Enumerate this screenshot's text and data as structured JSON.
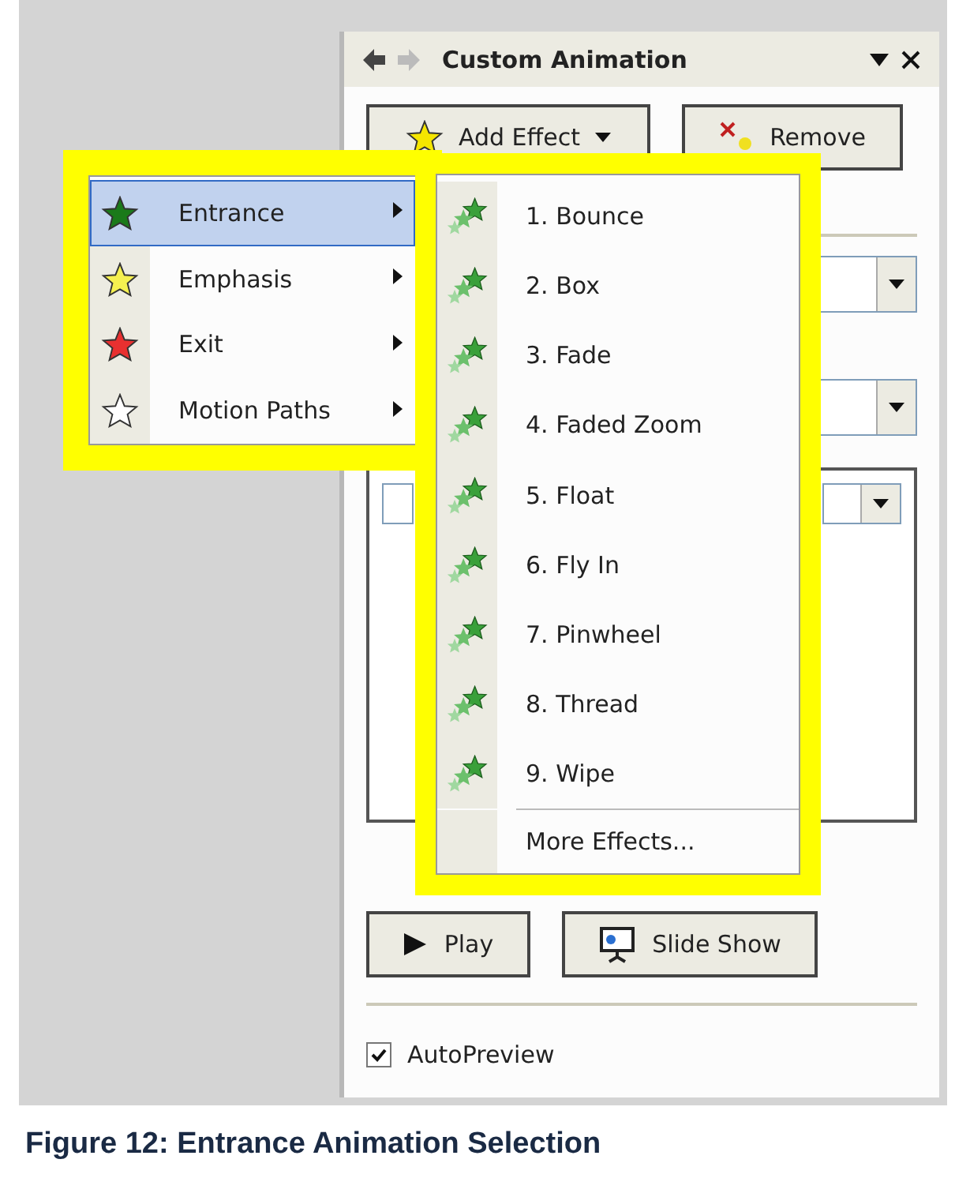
{
  "panel": {
    "title": "Custom Animation",
    "top_buttons": [
      {
        "label": "Add Effect",
        "kind": "add"
      },
      {
        "label": "Remove",
        "kind": "remove"
      }
    ],
    "bottom_buttons": [
      {
        "label": "Play",
        "kind": "play"
      },
      {
        "label": "Slide Show",
        "kind": "slideshow"
      }
    ],
    "autopreview": {
      "label": "AutoPreview",
      "checked": true
    }
  },
  "menu": {
    "items": [
      {
        "label": "Entrance",
        "kind": "entrance",
        "selected": true
      },
      {
        "label": "Emphasis",
        "kind": "emphasis",
        "selected": false
      },
      {
        "label": "Exit",
        "kind": "exit",
        "selected": false
      },
      {
        "label": "Motion Paths",
        "kind": "motion",
        "selected": false
      }
    ]
  },
  "submenu": {
    "items": [
      {
        "label": "1. Bounce"
      },
      {
        "label": "2. Box"
      },
      {
        "label": "3. Fade"
      },
      {
        "label": "4. Faded Zoom"
      },
      {
        "label": "5. Float"
      },
      {
        "label": "6. Fly In"
      },
      {
        "label": "7. Pinwheel"
      },
      {
        "label": "8. Thread"
      },
      {
        "label": "9. Wipe"
      }
    ],
    "more": "More Effects..."
  },
  "caption": "Figure 12: Entrance Animation Selection"
}
